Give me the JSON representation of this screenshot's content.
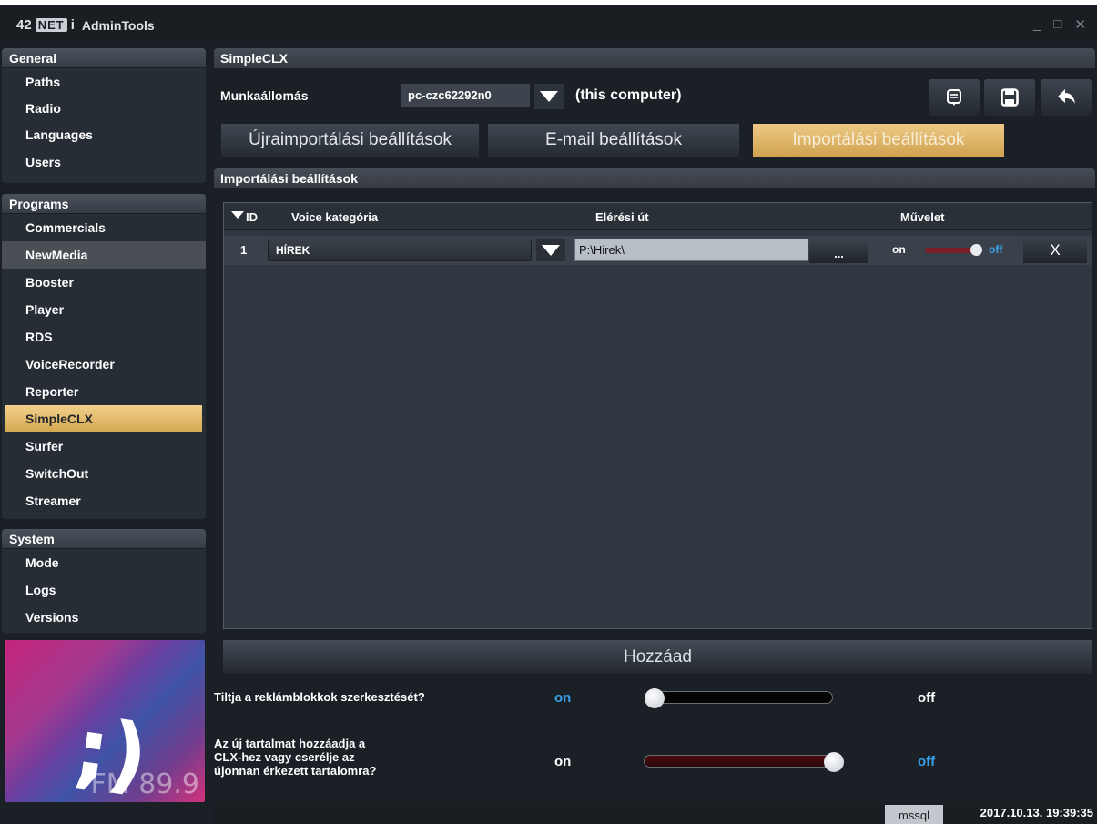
{
  "app": {
    "logo_num": "42",
    "logo_net": "NET",
    "logo_i": "i",
    "title": "AdminTools"
  },
  "window_controls": {
    "minimize": "_",
    "maximize": "□",
    "close": "✕"
  },
  "sidebar": {
    "groups": [
      {
        "title": "General",
        "items": [
          "Paths",
          "Radio",
          "Languages",
          "Users"
        ]
      },
      {
        "title": "Programs",
        "items": [
          "Commercials",
          "NewMedia",
          "Booster",
          "Player",
          "RDS",
          "VoiceRecorder",
          "Reporter",
          "SimpleCLX",
          "Surfer",
          "SwitchOut",
          "Streamer"
        ],
        "active": "SimpleCLX",
        "highlighted": "NewMedia"
      },
      {
        "title": "System",
        "items": [
          "Mode",
          "Logs",
          "Versions"
        ]
      }
    ],
    "promo": {
      "face": ";)",
      "text": "FM 89.9"
    }
  },
  "main": {
    "title": "SimpleCLX",
    "workstation": {
      "label": "Munkaállomás",
      "value": "pc-czc62292n0",
      "note": "(this computer)"
    },
    "toolbar": {
      "notes_icon": "notes-icon",
      "save_icon": "save-icon",
      "back_icon": "back-icon"
    },
    "tabs": [
      "Újraimportálási beállítások",
      "E-mail beállítások",
      "Importálási beállítások"
    ],
    "active_tab": "Importálási beállítások",
    "section_title": "Importálási beállítások",
    "table": {
      "columns": {
        "id": "ID",
        "voice": "Voice kategória",
        "path": "Elérési út",
        "action": "Művelet"
      },
      "rows": [
        {
          "id": "1",
          "voice": "HÍREK",
          "path": "P:\\Hirek\\",
          "browse": "...",
          "on": "on",
          "off": "off",
          "state": "on",
          "delete": "X"
        }
      ]
    },
    "add_button": "Hozzáad",
    "options": [
      {
        "label": "Tiltja a reklámblokkok szerkesztését?",
        "on": "on",
        "off": "off",
        "state": "off"
      },
      {
        "label": "Az új tartalmat hozzáadja a CLX-hez vagy cserélje az újonnan érkezett tartalomra?",
        "on": "on",
        "off": "off",
        "state": "on"
      }
    ]
  },
  "status": {
    "db": "mssql",
    "timestamp": "2017.10.13. 19:39:35"
  },
  "colors": {
    "accent": "#d6a955",
    "on_blue": "#3aa0e8",
    "track_red": "#5a0f15"
  }
}
